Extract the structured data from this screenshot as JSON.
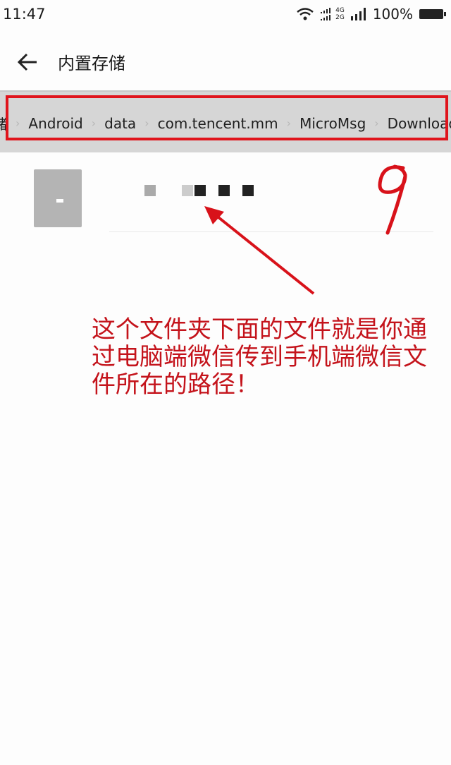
{
  "status_bar": {
    "time": "11:47",
    "network_4g": "4G",
    "network_2g": "2G",
    "battery": "100%"
  },
  "header": {
    "title": "内置存储",
    "back_icon": "arrow-left-icon"
  },
  "breadcrumb": {
    "items": [
      "储",
      "Android",
      "data",
      "com.tencent.mm",
      "MicroMsg",
      "Download"
    ]
  },
  "annotation": {
    "lines": [
      "这个文件夹下面的文件就是你通",
      "过电脑端微信传到手机端微信文",
      "件所在的路径！"
    ],
    "handwritten_mark": "9",
    "color": "#c4131b"
  }
}
